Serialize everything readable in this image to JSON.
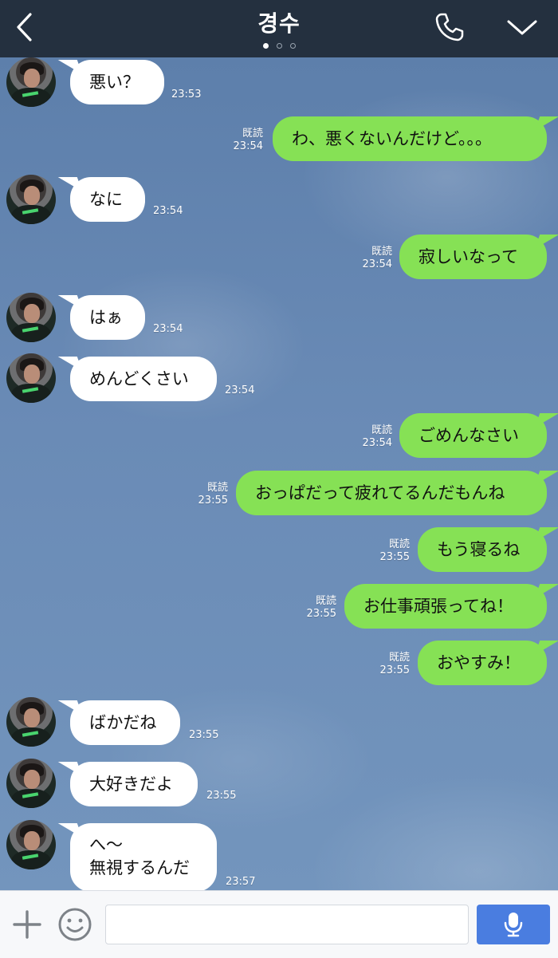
{
  "header": {
    "title": "경수",
    "back_icon": "chevron-left-icon",
    "call_icon": "phone-icon",
    "menu_icon": "chevron-down-icon",
    "page_dots": 3,
    "active_dot": 1
  },
  "messages": [
    {
      "side": "left",
      "text": "悪い？",
      "time": "23:53"
    },
    {
      "side": "right",
      "text": "わ、悪くないんだけど。。。",
      "read": "既読",
      "time": "23:54"
    },
    {
      "side": "left",
      "text": "なに",
      "time": "23:54"
    },
    {
      "side": "right",
      "text": "寂しいなって",
      "read": "既読",
      "time": "23:54"
    },
    {
      "side": "left",
      "text": "はぁ",
      "time": "23:54"
    },
    {
      "side": "left",
      "text": "めんどくさい",
      "time": "23:54"
    },
    {
      "side": "right",
      "text": "ごめんなさい",
      "read": "既読",
      "time": "23:54"
    },
    {
      "side": "right",
      "text": "おっぱだって疲れてるんだもんね",
      "read": "既読",
      "time": "23:55"
    },
    {
      "side": "right",
      "text": "もう寝るね",
      "read": "既読",
      "time": "23:55"
    },
    {
      "side": "right",
      "text": "お仕事頑張ってね！",
      "read": "既読",
      "time": "23:55"
    },
    {
      "side": "right",
      "text": "おやすみ！",
      "read": "既読",
      "time": "23:55"
    },
    {
      "side": "left",
      "text": "ばかだね",
      "time": "23:55"
    },
    {
      "side": "left",
      "text": "大好きだよ",
      "time": "23:55"
    },
    {
      "side": "left",
      "text": "へ〜\n無視するんだ",
      "time": "23:57"
    }
  ],
  "composer": {
    "plus_icon": "plus-icon",
    "emoji_icon": "smiley-icon",
    "input_placeholder": "",
    "mic_icon": "microphone-icon"
  },
  "colors": {
    "header_bg": "#24303f",
    "chat_bg": "#6a8bb6",
    "incoming_bubble": "#ffffff",
    "outgoing_bubble": "#86e155",
    "mic_button": "#4a7de0"
  }
}
